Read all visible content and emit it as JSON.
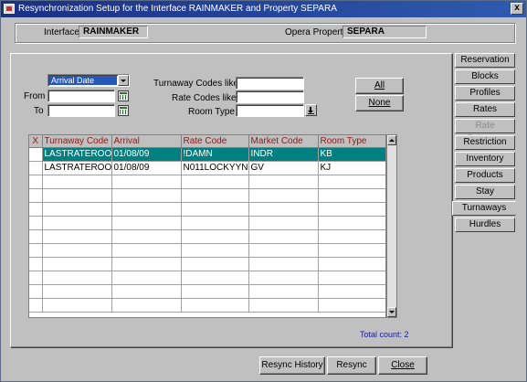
{
  "window": {
    "title": "Resynchronization Setup for the Interface RAINMAKER and Property SEPARA",
    "close_glyph": "x"
  },
  "header": {
    "interface_label": "Interface",
    "interface_value": "RAINMAKER",
    "property_label": "Opera Property",
    "property_value": "SEPARA"
  },
  "filters": {
    "date_type": "Arrival Date",
    "from_label": "From",
    "to_label": "To",
    "from_value": "",
    "to_value": "",
    "turnaway_codes_label": "Turnaway Codes like",
    "rate_codes_label": "Rate Codes like",
    "room_type_label": "Room Type",
    "turnaway_codes_value": "",
    "rate_codes_value": "",
    "room_type_value": ""
  },
  "actions": {
    "all_label": "All",
    "none_label": "None"
  },
  "grid": {
    "columns": [
      "X",
      "Turnaway Code",
      "Arrival",
      "Rate Code",
      "Market Code",
      "Room Type"
    ],
    "rows": [
      [
        "",
        "LASTRATEROOM",
        "01/08/09",
        "!DAMN",
        "INDR",
        "KB"
      ],
      [
        "",
        "LASTRATEROOM",
        "01/08/09",
        "N011LOCKYYN",
        "GV",
        "KJ"
      ],
      [
        "",
        "",
        "",
        "",
        "",
        ""
      ],
      [
        "",
        "",
        "",
        "",
        "",
        ""
      ],
      [
        "",
        "",
        "",
        "",
        "",
        ""
      ],
      [
        "",
        "",
        "",
        "",
        "",
        ""
      ],
      [
        "",
        "",
        "",
        "",
        "",
        ""
      ],
      [
        "",
        "",
        "",
        "",
        "",
        ""
      ],
      [
        "",
        "",
        "",
        "",
        "",
        ""
      ],
      [
        "",
        "",
        "",
        "",
        "",
        ""
      ],
      [
        "",
        "",
        "",
        "",
        "",
        ""
      ],
      [
        "",
        "",
        "",
        "",
        "",
        ""
      ]
    ],
    "selected_row": 0,
    "total_count": "Total count: 2"
  },
  "tabs": [
    {
      "label": "Reservation",
      "state": "normal"
    },
    {
      "label": "Blocks",
      "state": "normal"
    },
    {
      "label": "Profiles",
      "state": "normal"
    },
    {
      "label": "Rates",
      "state": "normal"
    },
    {
      "label": "Rate Category",
      "state": "disabled"
    },
    {
      "label": "Restriction",
      "state": "normal"
    },
    {
      "label": "Inventory",
      "state": "normal"
    },
    {
      "label": "Products",
      "state": "normal"
    },
    {
      "label": "Stay",
      "state": "normal"
    },
    {
      "label": "Turnaways",
      "state": "active"
    },
    {
      "label": "Hurdles",
      "state": "normal"
    }
  ],
  "footer": {
    "resync_history_label": "Resync History",
    "resync_label": "Resync",
    "close_label": "Close"
  },
  "colors": {
    "title_bar": "#1b2f82",
    "selected_row": "#008080",
    "header_text": "#8b1a1a",
    "count_text": "#1a1a9a"
  }
}
